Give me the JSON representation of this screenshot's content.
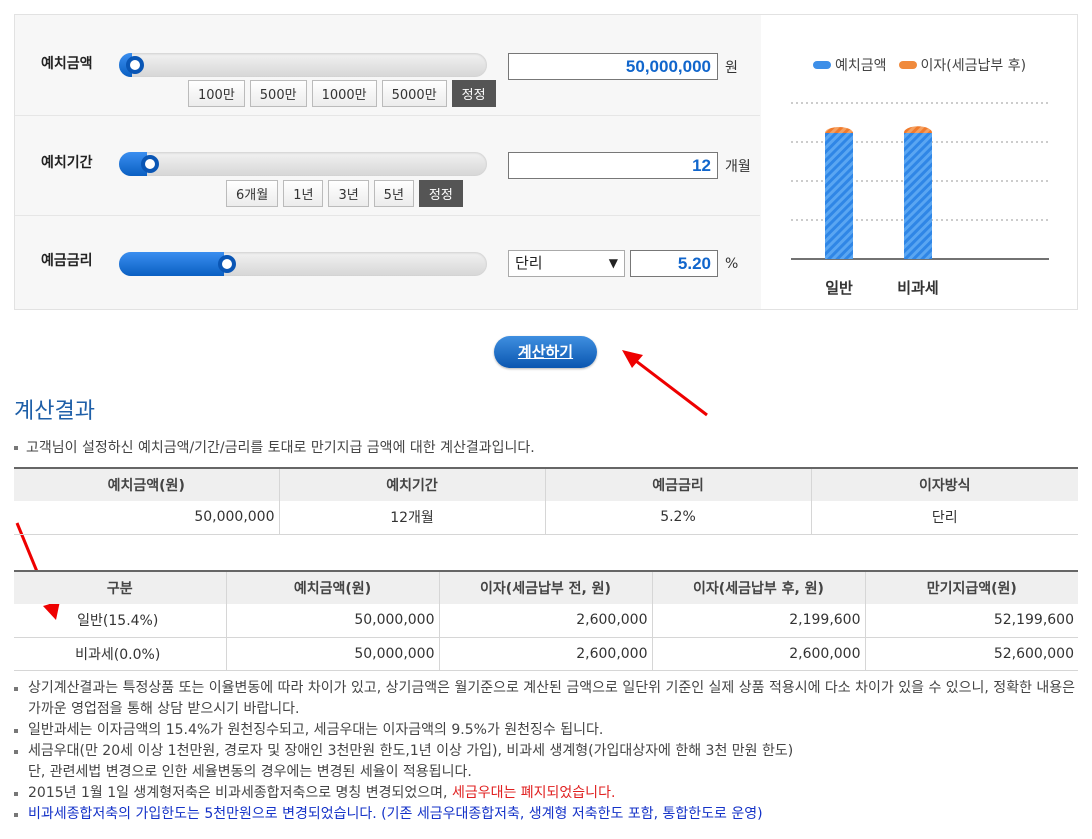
{
  "calculator": {
    "deposit": {
      "label": "예치금액",
      "value": "50,000,000",
      "unit": "원",
      "slider_fraction": 0.02,
      "buttons": [
        "100만",
        "500만",
        "1000만",
        "5000만"
      ],
      "fix_label": "정정"
    },
    "period": {
      "label": "예치기간",
      "value": "12",
      "unit": "개월",
      "slider_fraction": 0.06,
      "buttons": [
        "6개월",
        "1년",
        "3년",
        "5년"
      ],
      "fix_label": "정정"
    },
    "rate": {
      "label": "예금금리",
      "method": "단리",
      "value": "5.20",
      "unit": "%",
      "slider_fraction": 0.27
    }
  },
  "chart_data": {
    "type": "bar",
    "categories": [
      "일반",
      "비과세"
    ],
    "series": [
      {
        "name": "예치금액",
        "values": [
          50000000,
          50000000
        ],
        "color": "#3d8fe8"
      },
      {
        "name": "이자(세금납부 후)",
        "values": [
          2199600,
          2600000
        ],
        "color": "#f08a3c"
      }
    ],
    "stacked": true,
    "ylim": [
      0,
      60000000
    ],
    "grid": true,
    "legend": "top"
  },
  "calc_button": "계산하기",
  "result": {
    "title": "계산결과",
    "description": "고객님이 설정하신 예치금액/기간/금리를 토대로 만기지급 금액에 대한 계산결과입니다.",
    "summary_headers": [
      "예치금액(원)",
      "예치기간",
      "예금금리",
      "이자방식"
    ],
    "summary_values": [
      "50,000,000",
      "12개월",
      "5.2%",
      "단리"
    ],
    "detail_headers": [
      "구분",
      "예치금액(원)",
      "이자(세금납부 전, 원)",
      "이자(세금납부 후, 원)",
      "만기지급액(원)"
    ],
    "detail_rows": [
      [
        "일반(15.4%)",
        "50,000,000",
        "2,600,000",
        "2,199,600",
        "52,199,600"
      ],
      [
        "비과세(0.0%)",
        "50,000,000",
        "2,600,000",
        "2,600,000",
        "52,600,000"
      ]
    ]
  },
  "notes": {
    "n1": "상기계산결과는 특정상품 또는 이율변동에 따라 차이가 있고, 상기금액은 월기준으로 계산된 금액으로 일단위 기준인 실제 상품 적용시에 다소 차이가 있을 수 있으니, 정확한 내용은 가까운 영업점을 통해 상담 받으시기 바랍니다.",
    "n2": "일반과세는 이자금액의 15.4%가 원천징수되고, 세금우대는 이자금액의 9.5%가 원천징수 됩니다.",
    "n3a": "세금우대(만 20세 이상 1천만원, 경로자 및 장애인 3천만원 한도,1년 이상 가입), 비과세 생계형(가입대상자에 한해 3천 만원 한도)",
    "n3b": "단, 관련세법 변경으로 인한 세율변동의 경우에는 변경된 세율이 적용됩니다.",
    "n4a": "2015년 1월 1일 생계형저축은 비과세종합저축으로 명칭 변경되었으며, ",
    "n4b": "세금우대는 폐지되었습니다.",
    "n5": "비과세종합저축의 가입한도는 5천만원으로 변경되었습니다. (기존 세금우대종합저축, 생계형 저축한도 포함, 통합한도로 운영)"
  }
}
